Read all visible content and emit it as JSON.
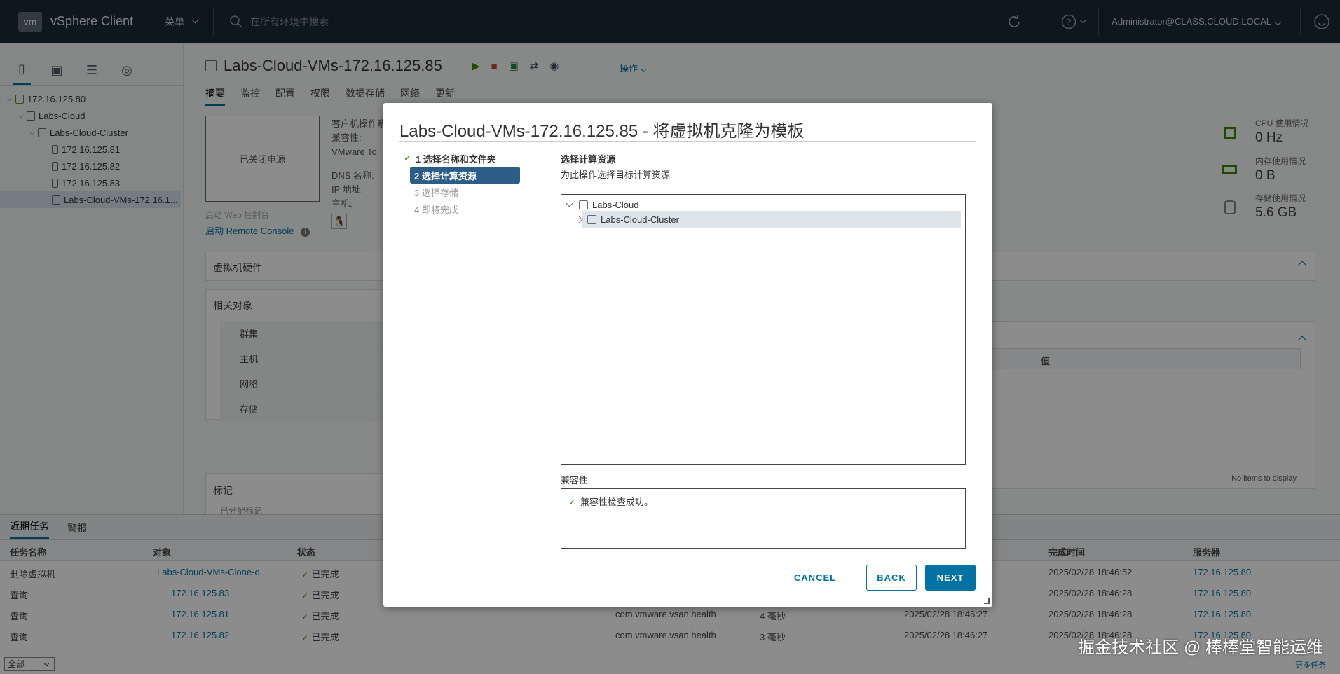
{
  "topbar": {
    "logo": "vm",
    "app_name": "vSphere Client",
    "menu_label": "菜单",
    "search_placeholder": "在所有环境中搜索",
    "user": "Administrator@CLASS.CLOUD.LOCAL"
  },
  "left_tree": {
    "items": [
      {
        "label": "172.16.125.80",
        "icon": "vcenter-icon"
      },
      {
        "label": "Labs-Cloud",
        "icon": "datacenter-icon"
      },
      {
        "label": "Labs-Cloud-Cluster",
        "icon": "cluster-icon"
      },
      {
        "label": "172.16.125.81",
        "icon": "host-icon"
      },
      {
        "label": "172.16.125.82",
        "icon": "host-icon"
      },
      {
        "label": "172.16.125.83",
        "icon": "host-icon"
      },
      {
        "label": "Labs-Cloud-VMs-172.16.1...",
        "icon": "vm-icon"
      }
    ]
  },
  "main": {
    "vm_title": "Labs-Cloud-VMs-172.16.125.85",
    "actions_label": "操作",
    "tabs": [
      "摘要",
      "监控",
      "配置",
      "权限",
      "数据存储",
      "网络",
      "更新"
    ],
    "power_state": "已关闭电源",
    "info_labels": [
      "客户机操作系",
      "兼容性:",
      "VMware To",
      "",
      "DNS 名称:",
      "IP 地址:",
      "主机:"
    ],
    "web_console": "启动 Web 控制台",
    "remote_console": "启动 Remote Console",
    "hardware_title": "虚拟机硬件",
    "related_title": "相关对象",
    "related_items": [
      "群集",
      "主机",
      "网络",
      "存储"
    ],
    "tags_title": "标记",
    "tags_partial": "已分配标记",
    "value_col": "值",
    "no_items": "No items to display",
    "stats": [
      {
        "label": "CPU 使用情况",
        "value": "0 Hz"
      },
      {
        "label": "内存使用情况",
        "value": "0 B"
      },
      {
        "label": "存储使用情况",
        "value": "5.6 GB"
      }
    ]
  },
  "bottom": {
    "tabs": [
      "近期任务",
      "警报"
    ],
    "headers": [
      "任务名称",
      "对象",
      "状态",
      "完成时间",
      "服务器"
    ],
    "rows": [
      {
        "task": "删除虚拟机",
        "object": "Labs-Cloud-VMs-Clone-o...",
        "status": "已完成",
        "extra": "",
        "dur": "",
        "queued": "",
        "done": "2025/02/28 18:46:52",
        "server": "172.16.125.80"
      },
      {
        "task": "查询",
        "object": "172.16.125.83",
        "status": "已完成",
        "extra": "",
        "dur": "",
        "queued": "",
        "done": "2025/02/28 18:46:28",
        "server": "172.16.125.80"
      },
      {
        "task": "查询",
        "object": "172.16.125.81",
        "status": "已完成",
        "extra": "com.vmware.vsan.health",
        "dur": "4 毫秒",
        "queued": "2025/02/28 18:46:27",
        "done": "2025/02/28 18:46:28",
        "server": "172.16.125.80"
      },
      {
        "task": "查询",
        "object": "172.16.125.82",
        "status": "已完成",
        "extra": "com.vmware.vsan.health",
        "dur": "3 毫秒",
        "queued": "2025/02/28 18:46:27",
        "done": "2025/02/28 18:46:28",
        "server": "172.16.125.80"
      }
    ],
    "filter": "全部",
    "more_tasks": "更多任务"
  },
  "modal": {
    "title": "Labs-Cloud-VMs-172.16.125.85 - 将虚拟机克隆为模板",
    "steps": [
      {
        "label": "1 选择名称和文件夹",
        "state": "done"
      },
      {
        "label": "2 选择计算资源",
        "state": "current"
      },
      {
        "label": "3 选择存储",
        "state": "future"
      },
      {
        "label": "4 即将完成",
        "state": "future"
      }
    ],
    "section_title": "选择计算资源",
    "section_subtitle": "为此操作选择目标计算资源",
    "tree": [
      {
        "label": "Labs-Cloud",
        "expanded": true
      },
      {
        "label": "Labs-Cloud-Cluster",
        "expanded": false,
        "selected": true
      }
    ],
    "compat_label": "兼容性",
    "compat_message": "兼容性检查成功。",
    "buttons": {
      "cancel": "CANCEL",
      "back": "BACK",
      "next": "NEXT"
    }
  },
  "watermark": "掘金技术社区 @ 棒棒堂智能运维",
  "colors": {
    "accent": "#0072a3",
    "topbar": "#1b2a32",
    "step_current": "#2c5d88",
    "success": "#3c8500"
  }
}
